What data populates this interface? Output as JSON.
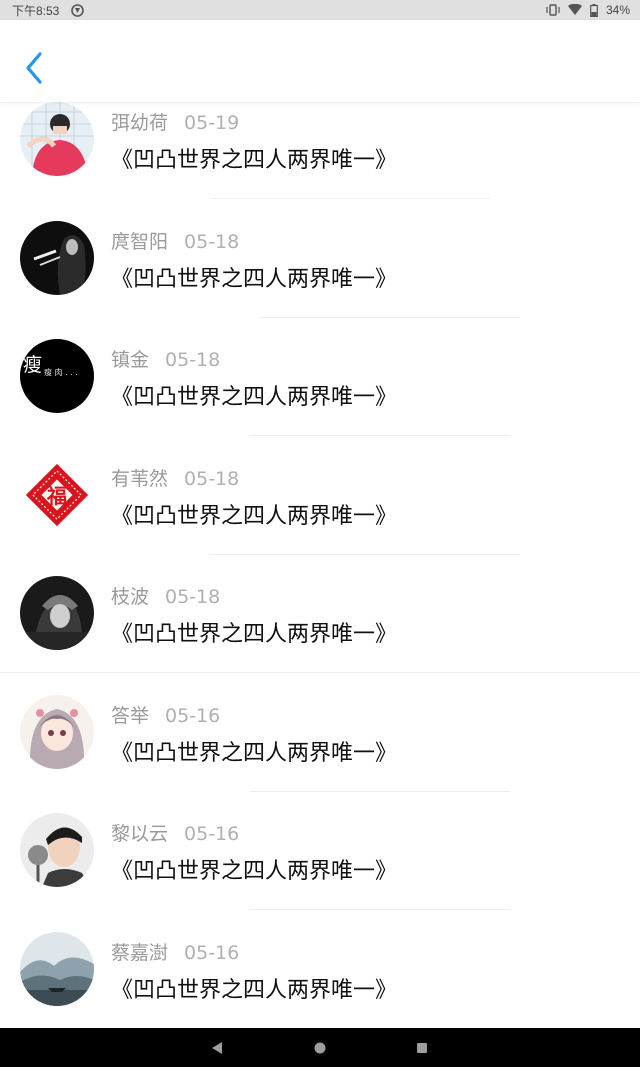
{
  "status_bar": {
    "time": "下午8:53",
    "battery": "34%",
    "icons": [
      "sync-icon",
      "vibrate-icon",
      "wifi-icon",
      "battery-icon"
    ]
  },
  "header": {
    "back_icon": "chevron-left-icon",
    "accent_color": "#2196f3"
  },
  "items": [
    {
      "name": "弭幼荷",
      "date": "05-19",
      "title": "《凹凸世界之四人两界唯一》"
    },
    {
      "name": "庹智阳",
      "date": "05-18",
      "title": "《凹凸世界之四人两界唯一》"
    },
    {
      "name": "镇金",
      "date": "05-18",
      "title": "《凹凸世界之四人两界唯一》"
    },
    {
      "name": "有苇然",
      "date": "05-18",
      "title": "《凹凸世界之四人两界唯一》"
    },
    {
      "name": "枝波",
      "date": "05-18",
      "title": "《凹凸世界之四人两界唯一》"
    },
    {
      "name": "答举",
      "date": "05-16",
      "title": "《凹凸世界之四人两界唯一》"
    },
    {
      "name": "黎以云",
      "date": "05-16",
      "title": "《凹凸世界之四人两界唯一》"
    },
    {
      "name": "蔡嘉澍",
      "date": "05-16",
      "title": "《凹凸世界之四人两界唯一》"
    }
  ],
  "avatar_text": {
    "item2": "瘦",
    "item3": "福"
  },
  "nav_bar": {
    "buttons": [
      "back-triangle-icon",
      "home-circle-icon",
      "recents-square-icon"
    ]
  }
}
